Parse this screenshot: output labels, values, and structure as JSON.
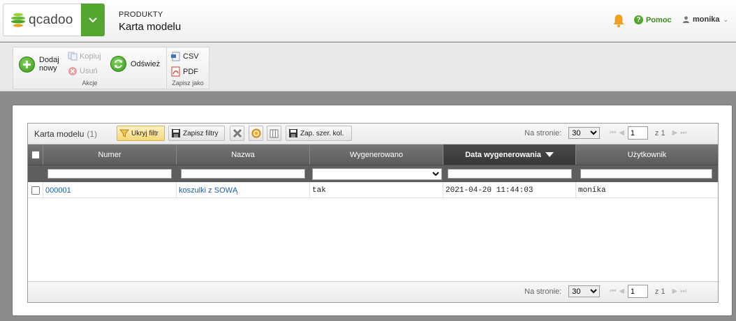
{
  "header": {
    "logo_text": "qcadoo",
    "category": "PRODUKTY",
    "title": "Karta modelu",
    "help_label": "Pomoc",
    "user_label": "monika",
    "brand_color": "#55a630"
  },
  "ribbon": {
    "groups": [
      {
        "caption": "Akcje",
        "items": [
          {
            "label_line1": "Dodaj",
            "label_line2": "nowy",
            "icon": "add-icon",
            "enabled": true
          },
          {
            "label": "Kopiuj",
            "icon": "copy-icon",
            "enabled": false
          },
          {
            "label": "Usuń",
            "icon": "delete-icon",
            "enabled": false
          },
          {
            "label": "Odśwież",
            "icon": "refresh-icon",
            "enabled": true
          }
        ]
      },
      {
        "caption": "Zapisz jako",
        "items": [
          {
            "label": "CSV",
            "icon": "csv-icon",
            "enabled": true
          },
          {
            "label": "PDF",
            "icon": "pdf-icon",
            "enabled": true
          }
        ]
      }
    ]
  },
  "grid": {
    "title": "Karta modelu",
    "count": "(1)",
    "toolbar": {
      "hide_filter": "Ukryj filtr",
      "save_filters": "Zapisz filtry",
      "save_widths": "Zap. szer. kol."
    },
    "pager": {
      "per_page_label": "Na stronie:",
      "per_page_value": "30",
      "page": "1",
      "of_label": "z 1"
    },
    "columns": [
      "Numer",
      "Nazwa",
      "Wygenerowano",
      "Data wygenerowania",
      "Użytkownik"
    ],
    "sorted_column": "Data wygenerowania",
    "sort_direction": "desc",
    "rows": [
      {
        "numer": "000001",
        "nazwa": "koszulki z SOWĄ",
        "wygenerowano": "tak",
        "data": "2021-04-20 11:44:03",
        "uzytkownik": "monika"
      }
    ]
  }
}
